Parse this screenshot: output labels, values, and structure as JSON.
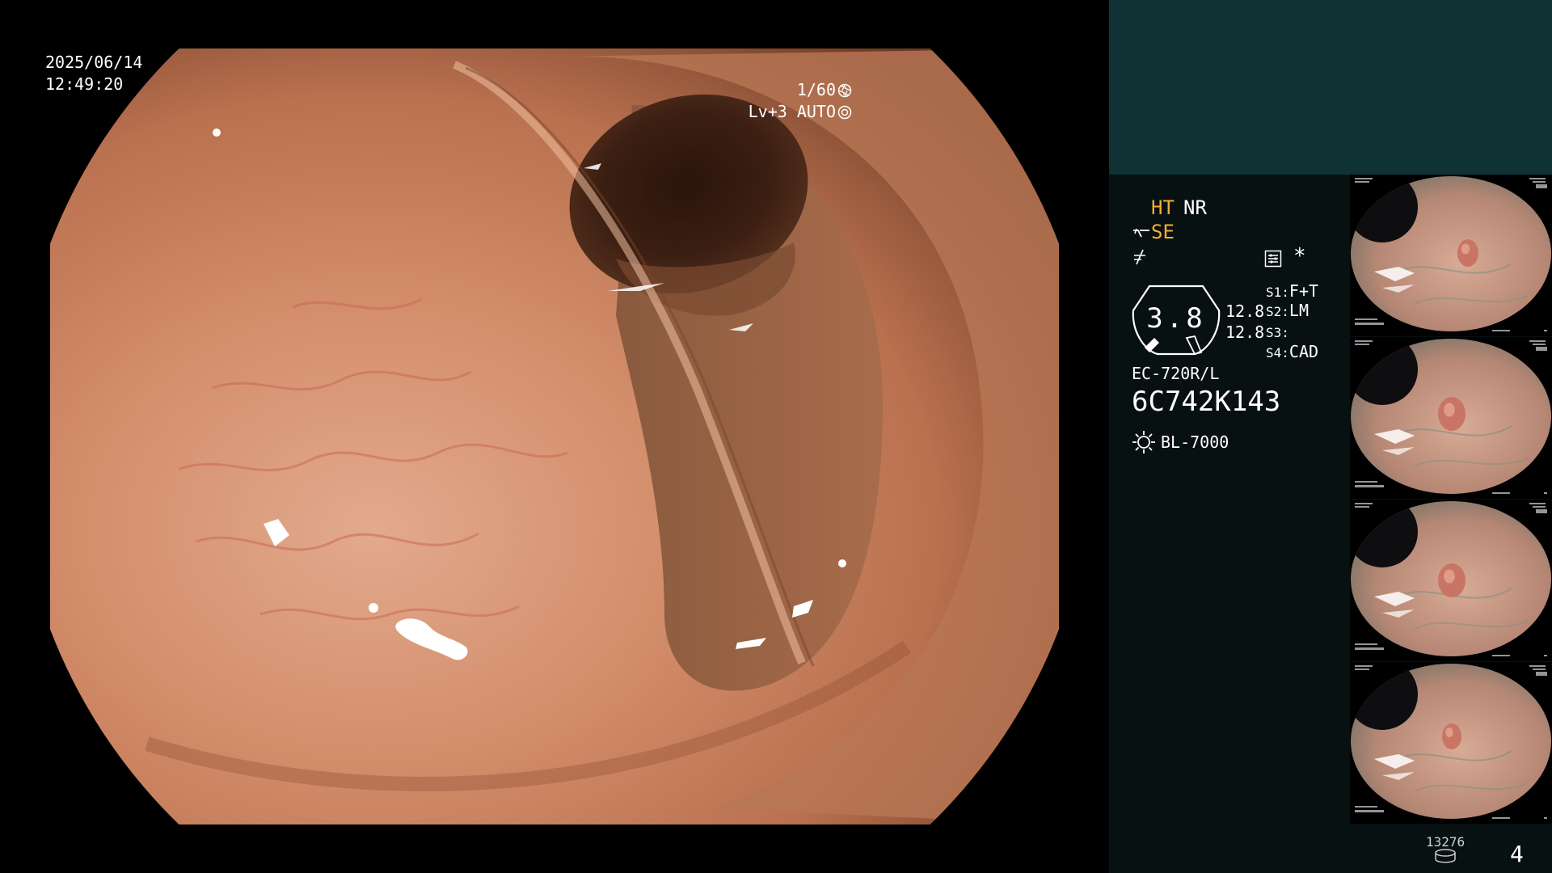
{
  "overlay": {
    "date": "2025/06/14",
    "time": "12:49:20",
    "shutter": "1/60",
    "level": "Lv+3 AUTO",
    "icons": [
      "aperture-icon",
      "iris-icon"
    ]
  },
  "status": {
    "ht": "HT",
    "nr": "NR",
    "se": "SE",
    "star": "*",
    "gauge_value": "3.8",
    "value_1": "12.8",
    "value_2": "12.8",
    "switches": [
      {
        "key": "S1:",
        "value": "F+T"
      },
      {
        "key": "S2:",
        "value": "LM"
      },
      {
        "key": "S3:",
        "value": ""
      },
      {
        "key": "S4:",
        "value": "CAD"
      }
    ],
    "scope_model": "EC-720R/L",
    "scope_serial": "6C742K143",
    "light_source": "BL-7000",
    "accent_color": "#f5ae34",
    "icons": [
      "se-icon",
      "notch-icon",
      "mode-icon",
      "sun-icon"
    ]
  },
  "thumbnails": {
    "count": 4,
    "storage_count": "13276",
    "page": "4"
  },
  "colors": {
    "panel_background": "#071112",
    "top_strip": "#0f3234"
  }
}
